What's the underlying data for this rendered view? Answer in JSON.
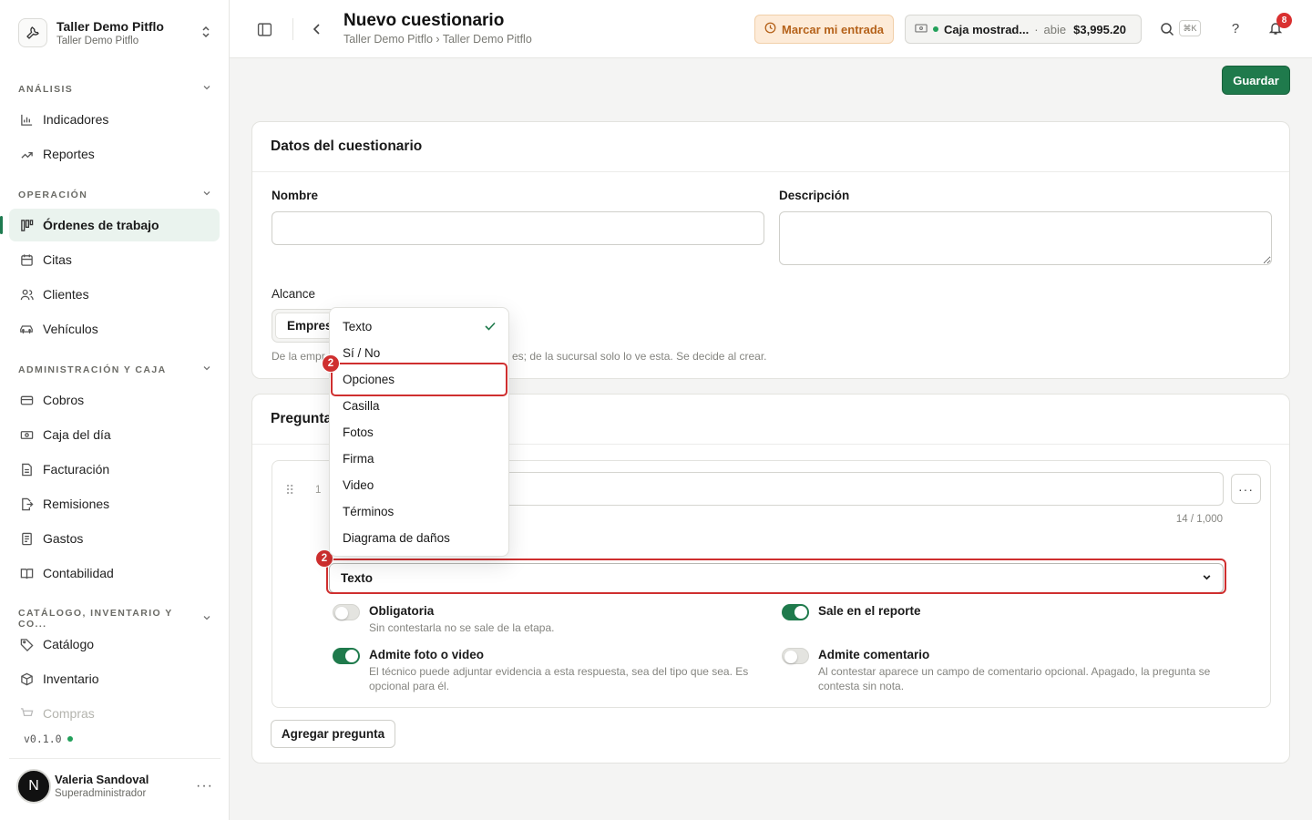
{
  "workspace": {
    "name": "Taller Demo Pitflo",
    "subtitle": "Taller Demo Pitflo"
  },
  "sidebar": {
    "sections": [
      {
        "label": "ANÁLISIS"
      },
      {
        "label": "OPERACIÓN"
      },
      {
        "label": "ADMINISTRACIÓN Y CAJA"
      },
      {
        "label": "CATÁLOGO, INVENTARIO Y CO..."
      }
    ],
    "items": [
      {
        "label": "Indicadores",
        "icon": "chart-bars-icon"
      },
      {
        "label": "Reportes",
        "icon": "trend-up-icon"
      },
      {
        "label": "Órdenes de trabajo",
        "icon": "kanban-icon",
        "active": true
      },
      {
        "label": "Citas",
        "icon": "calendar-icon"
      },
      {
        "label": "Clientes",
        "icon": "users-icon"
      },
      {
        "label": "Vehículos",
        "icon": "car-icon"
      },
      {
        "label": "Cobros",
        "icon": "credit-card-icon"
      },
      {
        "label": "Caja del día",
        "icon": "cash-icon"
      },
      {
        "label": "Facturación",
        "icon": "invoice-icon"
      },
      {
        "label": "Remisiones",
        "icon": "file-export-icon"
      },
      {
        "label": "Gastos",
        "icon": "receipt-icon"
      },
      {
        "label": "Contabilidad",
        "icon": "book-icon"
      },
      {
        "label": "Catálogo",
        "icon": "tag-icon"
      },
      {
        "label": "Inventario",
        "icon": "box-icon"
      },
      {
        "label": "Compras",
        "icon": "cart-icon"
      }
    ],
    "version": "v0.1.0",
    "user": {
      "initial": "N",
      "name": "Valeria Sandoval",
      "role": "Superadministrador"
    }
  },
  "header": {
    "title": "Nuevo cuestionario",
    "breadcrumb": "Taller Demo Pitflo › Taller Demo Pitflo",
    "mark_entry": "Marcar mi entrada",
    "cash": {
      "name": "Caja mostrad...",
      "sep": "·",
      "status": "abie",
      "amount": "$3,995.20"
    },
    "shortcut": "⌘K",
    "help": "?",
    "notifications": "8"
  },
  "actions": {
    "save": "Guardar"
  },
  "details": {
    "title": "Datos del cuestionario",
    "name_label": "Nombre",
    "name_value": "",
    "description_label": "Descripción",
    "description_value": "",
    "scope_label": "Alcance",
    "scope_option": "Empres",
    "scope_help_left": "De la empr",
    "scope_help_right": "es; de la sucursal solo lo ve esta. Se decide al crear."
  },
  "questions": {
    "title": "Pregunta",
    "number": "1",
    "counter": "14 / 1,000",
    "type_value": "Texto",
    "options": [
      {
        "title": "Obligatoria",
        "desc": "Sin contestarla no se sale de la etapa.",
        "on": false
      },
      {
        "title": "Sale en el reporte",
        "desc": "",
        "on": true
      },
      {
        "title": "Admite foto o video",
        "desc": "El técnico puede adjuntar evidencia a esta respuesta, sea del tipo que sea. Es opcional para él.",
        "on": true
      },
      {
        "title": "Admite comentario",
        "desc": "Al contestar aparece un campo de comentario opcional. Apagado, la pregunta se contesta sin nota.",
        "on": false
      }
    ],
    "add_label": "Agregar pregunta"
  },
  "type_dropdown": {
    "items": [
      "Texto",
      "Sí / No",
      "Opciones",
      "Casilla",
      "Fotos",
      "Firma",
      "Video",
      "Términos",
      "Diagrama de daños"
    ],
    "selected": "Texto",
    "highlighted": "Opciones"
  },
  "annotations": {
    "badge_option": "2",
    "badge_select": "2",
    "color": "#cf2f2f"
  }
}
